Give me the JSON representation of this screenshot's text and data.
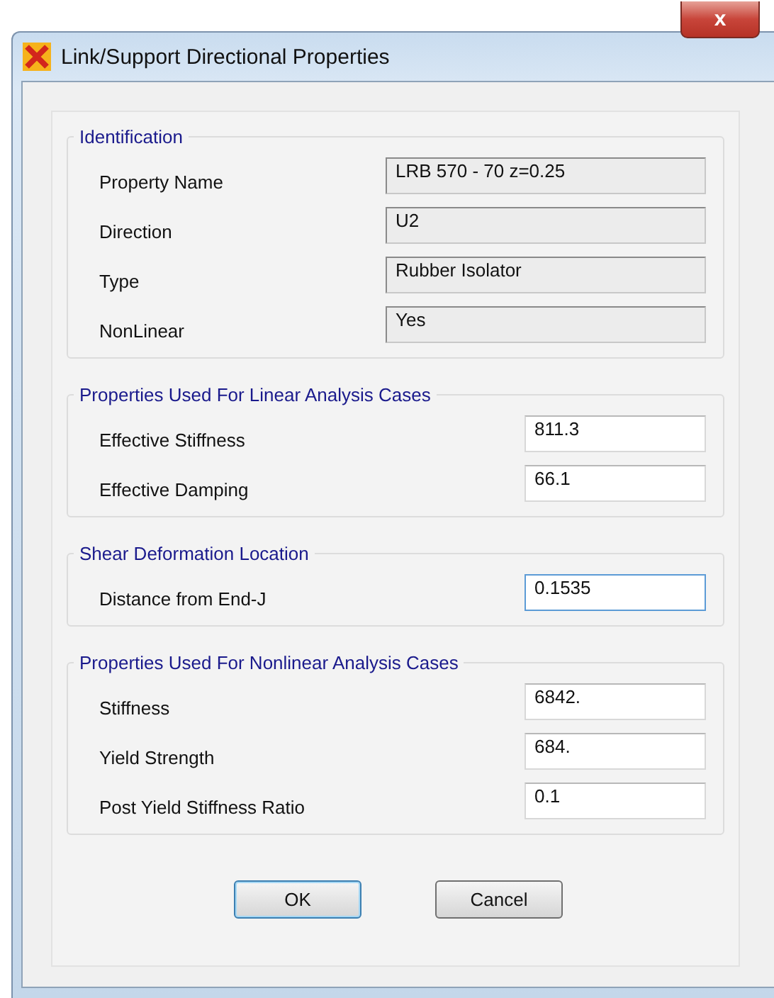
{
  "window": {
    "title": "Link/Support Directional Properties",
    "close": "x"
  },
  "groups": [
    {
      "title": "Identification",
      "fields": [
        {
          "label": "Property Name",
          "value": "LRB 570 - 70 z=0.25",
          "readonly": true,
          "focused": false
        },
        {
          "label": "Direction",
          "value": "U2",
          "readonly": true,
          "focused": false
        },
        {
          "label": "Type",
          "value": "Rubber Isolator",
          "readonly": true,
          "focused": false
        },
        {
          "label": "NonLinear",
          "value": "Yes",
          "readonly": true,
          "focused": false
        }
      ]
    },
    {
      "title": "Properties Used For Linear Analysis Cases",
      "fields": [
        {
          "label": "Effective Stiffness",
          "value": "811.3",
          "readonly": false,
          "focused": false
        },
        {
          "label": "Effective Damping",
          "value": "66.1",
          "readonly": false,
          "focused": false
        }
      ]
    },
    {
      "title": "Shear Deformation Location",
      "fields": [
        {
          "label": "Distance from End-J",
          "value": "0.1535",
          "readonly": false,
          "focused": true
        }
      ]
    },
    {
      "title": "Properties Used For Nonlinear Analysis Cases",
      "fields": [
        {
          "label": "Stiffness",
          "value": "6842.",
          "readonly": false,
          "focused": false
        },
        {
          "label": "Yield Strength",
          "value": "684.",
          "readonly": false,
          "focused": false
        },
        {
          "label": "Post Yield Stiffness Ratio",
          "value": "0.1",
          "readonly": false,
          "focused": false
        }
      ]
    }
  ],
  "buttons": [
    {
      "label": "OK",
      "default": true
    },
    {
      "label": "Cancel",
      "default": false
    }
  ]
}
